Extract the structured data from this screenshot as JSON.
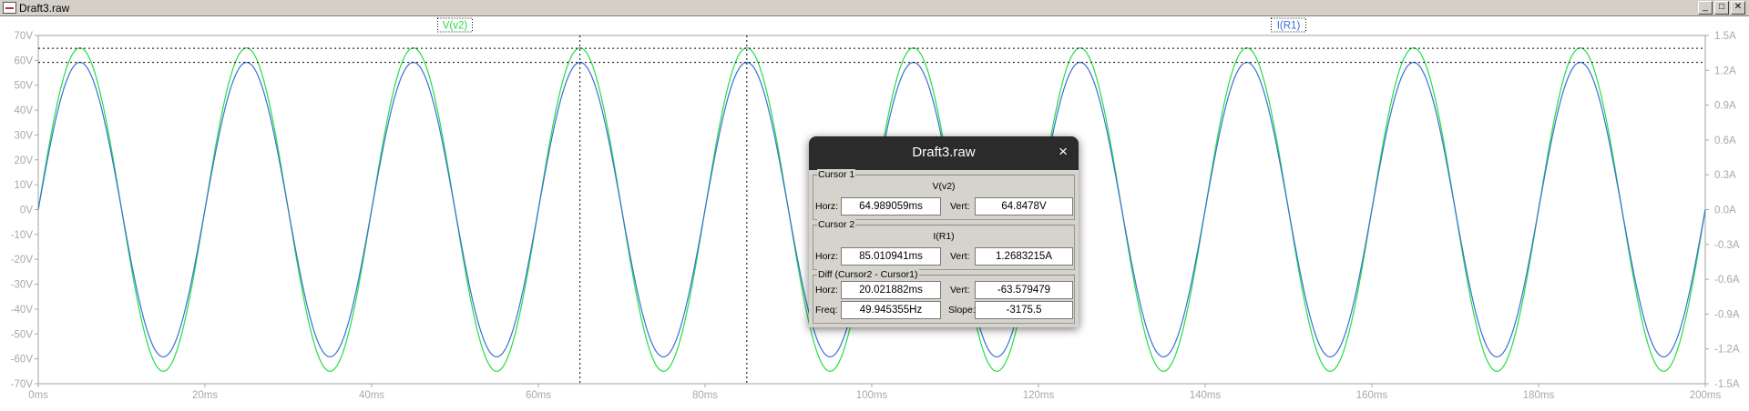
{
  "window": {
    "title": "Draft3.raw",
    "controls": [
      "_",
      "□",
      "✕"
    ]
  },
  "chart_data": {
    "type": "line",
    "x": {
      "min": 0,
      "max": 200,
      "unit": "ms",
      "ticks": [
        "0ms",
        "20ms",
        "40ms",
        "60ms",
        "80ms",
        "100ms",
        "120ms",
        "140ms",
        "160ms",
        "180ms",
        "200ms"
      ]
    },
    "y_left": {
      "min": -70,
      "max": 70,
      "ticks": [
        "70V",
        "60V",
        "50V",
        "40V",
        "30V",
        "20V",
        "10V",
        "0V",
        "-10V",
        "-20V",
        "-30V",
        "-40V",
        "-50V",
        "-60V",
        "-70V"
      ]
    },
    "y_right": {
      "min": -1.5,
      "max": 1.5,
      "ticks": [
        "1.5A",
        "1.2A",
        "0.9A",
        "0.6A",
        "0.3A",
        "0.0A",
        "-0.3A",
        "-0.6A",
        "-0.9A",
        "-1.2A",
        "-1.5A"
      ]
    },
    "series": [
      {
        "name": "V(v2)",
        "color": "#22dd44",
        "axis": "left",
        "amplitude": 65,
        "frequency_hz": 50,
        "unit": "V"
      },
      {
        "name": "I(R1)",
        "color": "#3a6fd6",
        "axis": "right",
        "amplitude": 1.2683,
        "frequency_hz": 50,
        "unit": "A"
      }
    ],
    "legend": [
      "V(v2)",
      "I(R1)"
    ],
    "cursors": {
      "cursor1": {
        "x": 64.989059,
        "y": 64.8478,
        "axis": "left"
      },
      "cursor2": {
        "x": 85.010941,
        "y": 1.2683215,
        "axis": "right"
      }
    },
    "grid": false
  },
  "dialog": {
    "title": "Draft3.raw",
    "close": "×",
    "cursor1": {
      "label": "Cursor 1",
      "trace": "V(v2)",
      "horz_label": "Horz:",
      "horz": "64.989059ms",
      "vert_label": "Vert:",
      "vert": "64.8478V"
    },
    "cursor2": {
      "label": "Cursor 2",
      "trace": "I(R1)",
      "horz_label": "Horz:",
      "horz": "85.010941ms",
      "vert_label": "Vert:",
      "vert": "1.2683215A"
    },
    "diff": {
      "label": "Diff (Cursor2 - Cursor1)",
      "horz_label": "Horz:",
      "horz": "20.021882ms",
      "vert_label": "Vert:",
      "vert": "-63.579479",
      "freq_label": "Freq:",
      "freq": "49.945355Hz",
      "slope_label": "Slope:",
      "slope": "-3175.5"
    }
  }
}
